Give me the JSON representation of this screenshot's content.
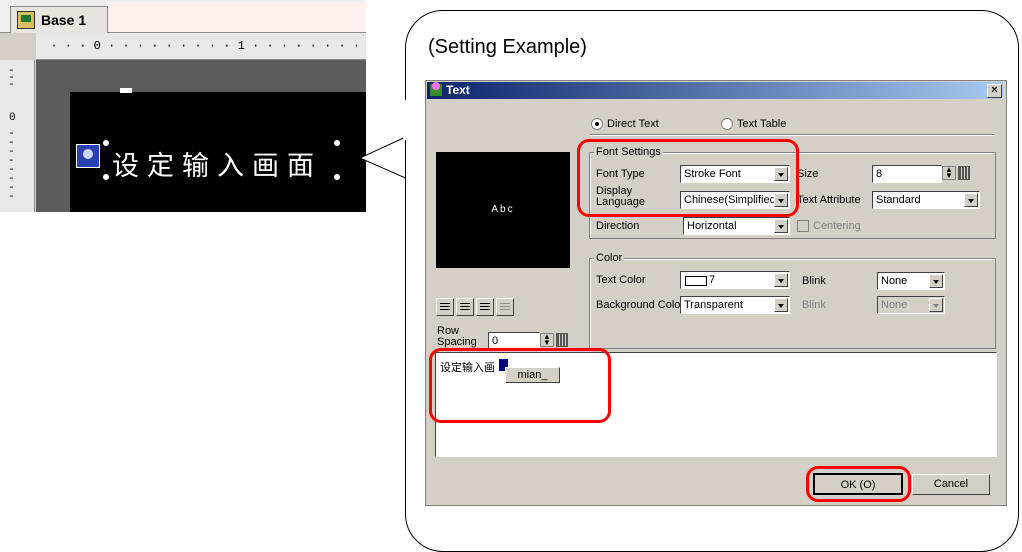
{
  "editor": {
    "tab_label": "Base 1",
    "ruler_text": "  · · · 0 · · · · · · · · · 1 · · · · · · · · · 2 ·",
    "vruler_zero": "0",
    "screen_text": "设定输入画面"
  },
  "callout": {
    "title": "(Setting Example)"
  },
  "dialog": {
    "title": "Text",
    "close_label": "×",
    "radio_direct": "Direct Text",
    "radio_table": "Text Table",
    "preview_text": "Abc",
    "font_settings": {
      "group_title": "Font Settings",
      "font_type_label": "Font Type",
      "font_type_value": "Stroke Font",
      "display_language_label": "Display Language",
      "display_language_value": "Chinese(Simplified)",
      "size_label": "Size",
      "size_value": "8",
      "text_attribute_label": "Text Attribute",
      "text_attribute_value": "Standard",
      "direction_label": "Direction",
      "direction_value": "Horizontal",
      "centering_label": "Centering"
    },
    "color": {
      "group_title": "Color",
      "text_color_label": "Text Color",
      "text_color_value": "7",
      "blink1_label": "Blink",
      "blink1_value": "None",
      "bg_color_label": "Background Color",
      "bg_color_value": "Transparent",
      "blink2_label": "Blink",
      "blink2_value": "None"
    },
    "row_spacing_label": "Row Spacing",
    "row_spacing_value": "0",
    "text_area_value": "设定输入画",
    "ime_popup": "mian_",
    "ok_label": "OK (O)",
    "cancel_label": "Cancel"
  },
  "colors": {
    "highlight_red": "#ff0000",
    "titlebar_start": "#0a246a",
    "dialog_bg": "#d4d0c8"
  }
}
